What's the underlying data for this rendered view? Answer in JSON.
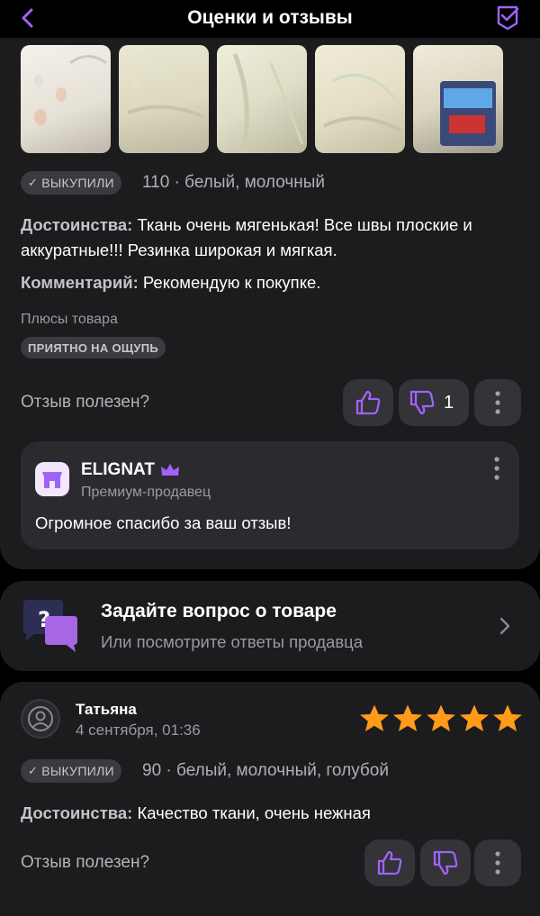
{
  "header": {
    "title": "Оценки и отзывы",
    "back_icon": "chevron-left-icon",
    "right_icon": "bag-check-icon",
    "accent": "#a063f6"
  },
  "review1": {
    "photos_count": 5,
    "bought_badge": "ВЫКУПИЛИ",
    "size_color": "110 · белый, молочный",
    "pros_label": "Достоинства:",
    "pros_text": "Ткань очень мягенькая! Все швы плоские и аккуратные!!! Резинка широкая и мягкая.",
    "comment_label": "Комментарий:",
    "comment_text": "Рекомендую к покупке.",
    "product_pros_title": "Плюсы товара",
    "tag": "ПРИЯТНО НА ОЩУПЬ",
    "helpful_label": "Отзыв полезен?",
    "dislike_count": "1",
    "seller_reply": {
      "name": "ELIGNAT",
      "status": "Премиум-продавец",
      "text": "Огромное спасибо за ваш отзыв!"
    }
  },
  "ask": {
    "title": "Задайте вопрос о товаре",
    "subtitle": "Или посмотрите ответы продавца"
  },
  "review2": {
    "author": "Татьяна",
    "date": "4 сентября, 01:36",
    "rating": 5,
    "bought_badge": "ВЫКУПИЛИ",
    "size_color": "90 · белый, молочный, голубой",
    "pros_label": "Достоинства:",
    "pros_text": "Качество ткани, очень нежная",
    "helpful_label": "Отзыв полезен?"
  }
}
